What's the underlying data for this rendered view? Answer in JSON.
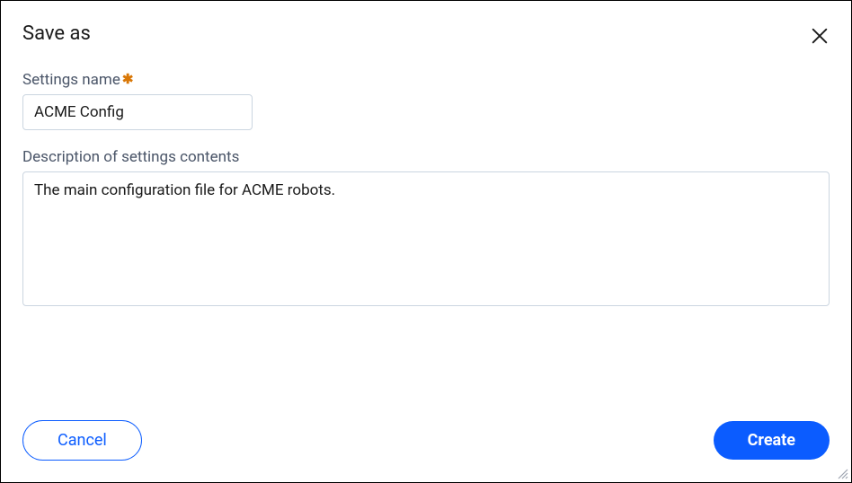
{
  "dialog": {
    "title": "Save as"
  },
  "fields": {
    "name": {
      "label": "Settings name",
      "value": "ACME Config",
      "required": true
    },
    "description": {
      "label": "Description of settings contents",
      "value": "The main configuration file for ACME robots."
    }
  },
  "buttons": {
    "cancel": "Cancel",
    "create": "Create"
  }
}
